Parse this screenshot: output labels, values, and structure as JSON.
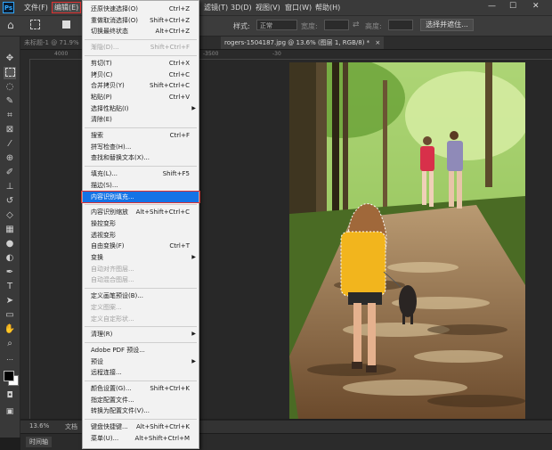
{
  "app": {
    "logo": "Ps"
  },
  "menubar": {
    "items": [
      "文件(F)",
      "编辑(E)",
      "滤镜(T)",
      "3D(D)",
      "视图(V)",
      "窗口(W)",
      "帮助(H)"
    ],
    "window_controls": [
      "—",
      "☐",
      "✕"
    ]
  },
  "options": {
    "style_label": "样式:",
    "style_value": "正常",
    "width_label": "宽度:",
    "height_label": "高度:",
    "select_mask": "选择并遮住..."
  },
  "tabs": {
    "inactive": "未标题-1 @ 71.9%",
    "active": "rogers-1504187.jpg @ 13.6% (图层 1, RGB/8) *",
    "active_close": "×"
  },
  "ruler": {
    "ticks": [
      "4000",
      "-3500",
      "-30"
    ]
  },
  "status": {
    "zoom": "13.6%",
    "doc": "文档"
  },
  "timeline": {
    "tab": "时间轴"
  },
  "edit_menu": {
    "groups": [
      [
        {
          "label": "还原快速选择(O)",
          "shortcut": "Ctrl+Z"
        },
        {
          "label": "重做取消选择(O)",
          "shortcut": "Shift+Ctrl+Z"
        },
        {
          "label": "切换最终状态",
          "shortcut": "Alt+Ctrl+Z"
        }
      ],
      [
        {
          "label": "渐隐(D)...",
          "shortcut": "Shift+Ctrl+F",
          "disabled": true
        }
      ],
      [
        {
          "label": "剪切(T)",
          "shortcut": "Ctrl+X"
        },
        {
          "label": "拷贝(C)",
          "shortcut": "Ctrl+C"
        },
        {
          "label": "合并拷贝(Y)",
          "shortcut": "Shift+Ctrl+C"
        },
        {
          "label": "粘贴(P)",
          "shortcut": "Ctrl+V"
        },
        {
          "label": "选择性粘贴(I)",
          "submenu": true
        },
        {
          "label": "清除(E)"
        }
      ],
      [
        {
          "label": "搜索",
          "shortcut": "Ctrl+F"
        },
        {
          "label": "拼写检查(H)..."
        },
        {
          "label": "查找和替换文本(X)..."
        }
      ],
      [
        {
          "label": "填充(L)...",
          "shortcut": "Shift+F5"
        },
        {
          "label": "描边(S)..."
        },
        {
          "label": "内容识别填充...",
          "highlighted": true
        }
      ],
      [
        {
          "label": "内容识别缩放",
          "shortcut": "Alt+Shift+Ctrl+C"
        },
        {
          "label": "操控变形"
        },
        {
          "label": "透视变形"
        },
        {
          "label": "自由变换(F)",
          "shortcut": "Ctrl+T"
        },
        {
          "label": "变换",
          "submenu": true
        },
        {
          "label": "自动对齐图层...",
          "disabled": true
        },
        {
          "label": "自动混合图层...",
          "disabled": true
        }
      ],
      [
        {
          "label": "定义画笔预设(B)..."
        },
        {
          "label": "定义图案...",
          "disabled": true
        },
        {
          "label": "定义自定形状...",
          "disabled": true
        }
      ],
      [
        {
          "label": "清理(R)",
          "submenu": true
        }
      ],
      [
        {
          "label": "Adobe PDF 预设..."
        },
        {
          "label": "预设",
          "submenu": true
        },
        {
          "label": "远程连接..."
        }
      ],
      [
        {
          "label": "颜色设置(G)...",
          "shortcut": "Shift+Ctrl+K"
        },
        {
          "label": "指定配置文件..."
        },
        {
          "label": "转换为配置文件(V)..."
        }
      ],
      [
        {
          "label": "键盘快捷键...",
          "shortcut": "Alt+Shift+Ctrl+K"
        },
        {
          "label": "菜单(U)...",
          "shortcut": "Alt+Shift+Ctrl+M"
        }
      ]
    ]
  },
  "colors": {
    "accent": "#1473e6",
    "highlight_border": "#e0302f"
  },
  "toolbar": {
    "icons": [
      "move-icon",
      "marquee-icon",
      "lasso-icon",
      "quick-select-icon",
      "crop-icon",
      "frame-icon",
      "eyedropper-icon",
      "healing-icon",
      "brush-icon",
      "stamp-icon",
      "history-brush-icon",
      "eraser-icon",
      "gradient-icon",
      "blur-icon",
      "dodge-icon",
      "pen-icon",
      "text-icon",
      "path-select-icon",
      "rectangle-icon",
      "hand-icon",
      "zoom-icon"
    ]
  }
}
